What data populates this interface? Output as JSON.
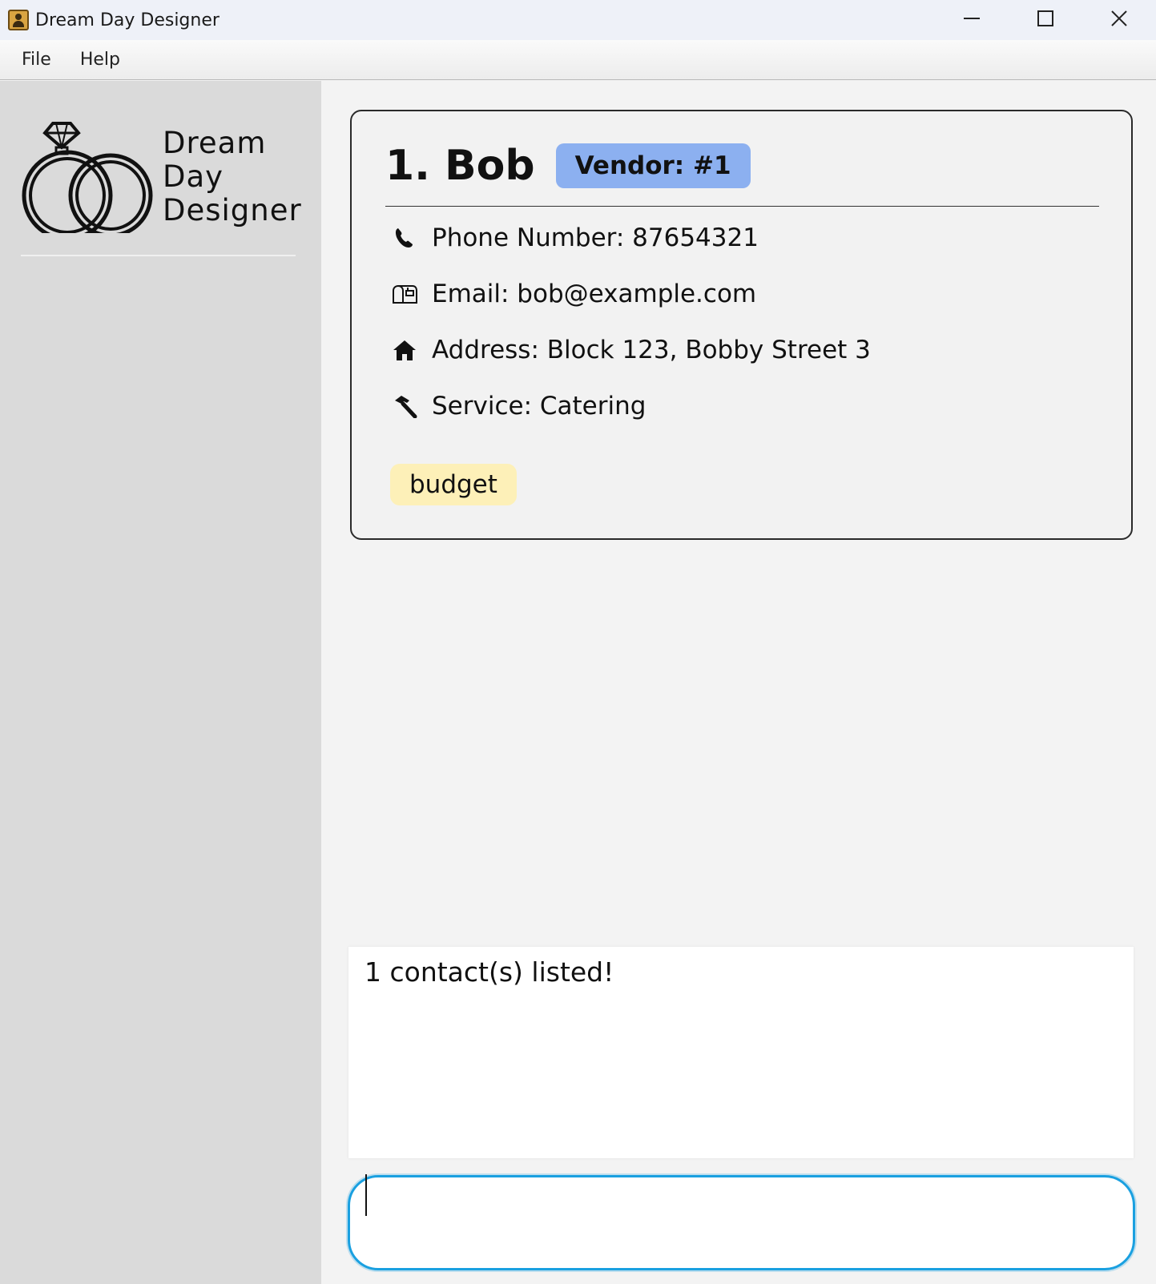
{
  "window": {
    "title": "Dream Day Designer",
    "controls": {
      "minimize": "—",
      "maximize": "☐",
      "close": "✕"
    }
  },
  "menu": {
    "items": [
      "File",
      "Help"
    ]
  },
  "sidebar": {
    "logo_lines": [
      "Dream",
      "Day",
      "Designer"
    ]
  },
  "contact_card": {
    "name": "1. Bob",
    "badge": "Vendor: #1",
    "phone": "Phone Number: 87654321",
    "email": "Email: bob@example.com",
    "address": "Address: Block 123, Bobby Street 3",
    "service": "Service: Catering",
    "tags": [
      "budget"
    ],
    "icons": [
      "phone-icon",
      "mailbox-icon",
      "home-icon",
      "hammer-icon"
    ]
  },
  "result": {
    "message": "1 contact(s) listed!"
  },
  "command": {
    "value": "",
    "placeholder": ""
  },
  "colors": {
    "badge": "#8cb0f0",
    "tag": "#fdf0b8",
    "input_border": "#1aa0e0",
    "sidebar": "#dadada"
  }
}
